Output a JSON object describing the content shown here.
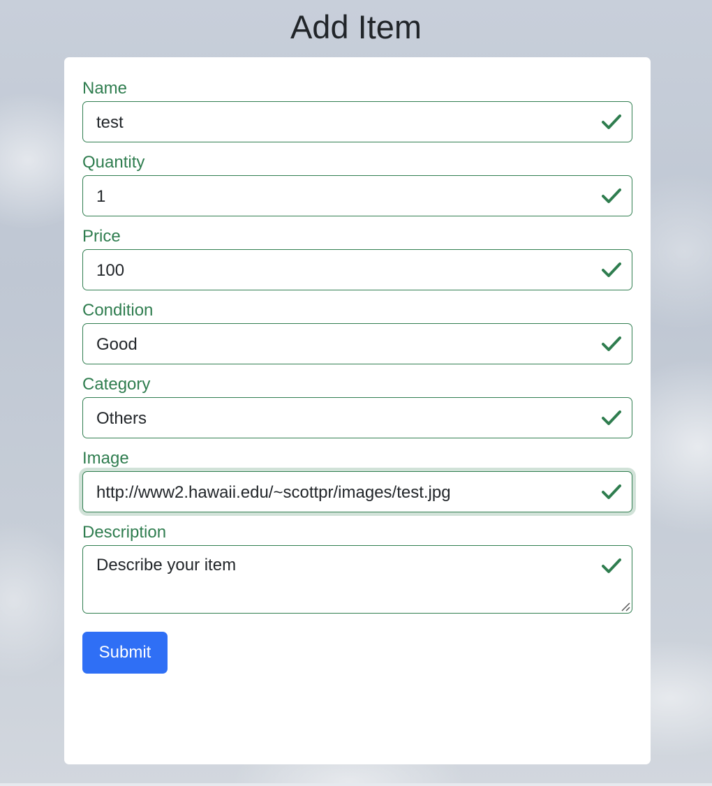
{
  "page": {
    "title": "Add Item"
  },
  "form": {
    "fields": [
      {
        "label": "Name",
        "value": "test"
      },
      {
        "label": "Quantity",
        "value": "1"
      },
      {
        "label": "Price",
        "value": "100"
      },
      {
        "label": "Condition",
        "value": "Good"
      },
      {
        "label": "Category",
        "value": "Others"
      },
      {
        "label": "Image",
        "value": "http://www2.hawaii.edu/~scottpr/images/test.jpg"
      }
    ],
    "description": {
      "label": "Description",
      "placeholder": "Describe your item"
    },
    "submit_label": "Submit"
  },
  "icons": {
    "valid": "check-icon",
    "resize": "resize-handle-icon"
  },
  "colors": {
    "valid_green": "#2f7d4f",
    "primary_blue": "#2f6ff5",
    "title_text": "#212529"
  }
}
